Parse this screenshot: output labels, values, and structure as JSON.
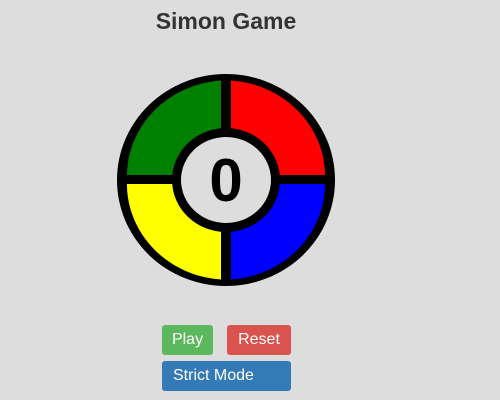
{
  "game": {
    "title": "Simon Game",
    "counter": "0",
    "pads": [
      {
        "name": "green",
        "color": "#008000"
      },
      {
        "name": "red",
        "color": "#ff0000"
      },
      {
        "name": "yellow",
        "color": "#ffff00"
      },
      {
        "name": "blue",
        "color": "#0000ff"
      }
    ],
    "center_color": "#dddddd",
    "outline_color": "#000000"
  },
  "controls": {
    "play_label": "Play",
    "reset_label": "Reset",
    "strict_label": "Strict Mode"
  }
}
